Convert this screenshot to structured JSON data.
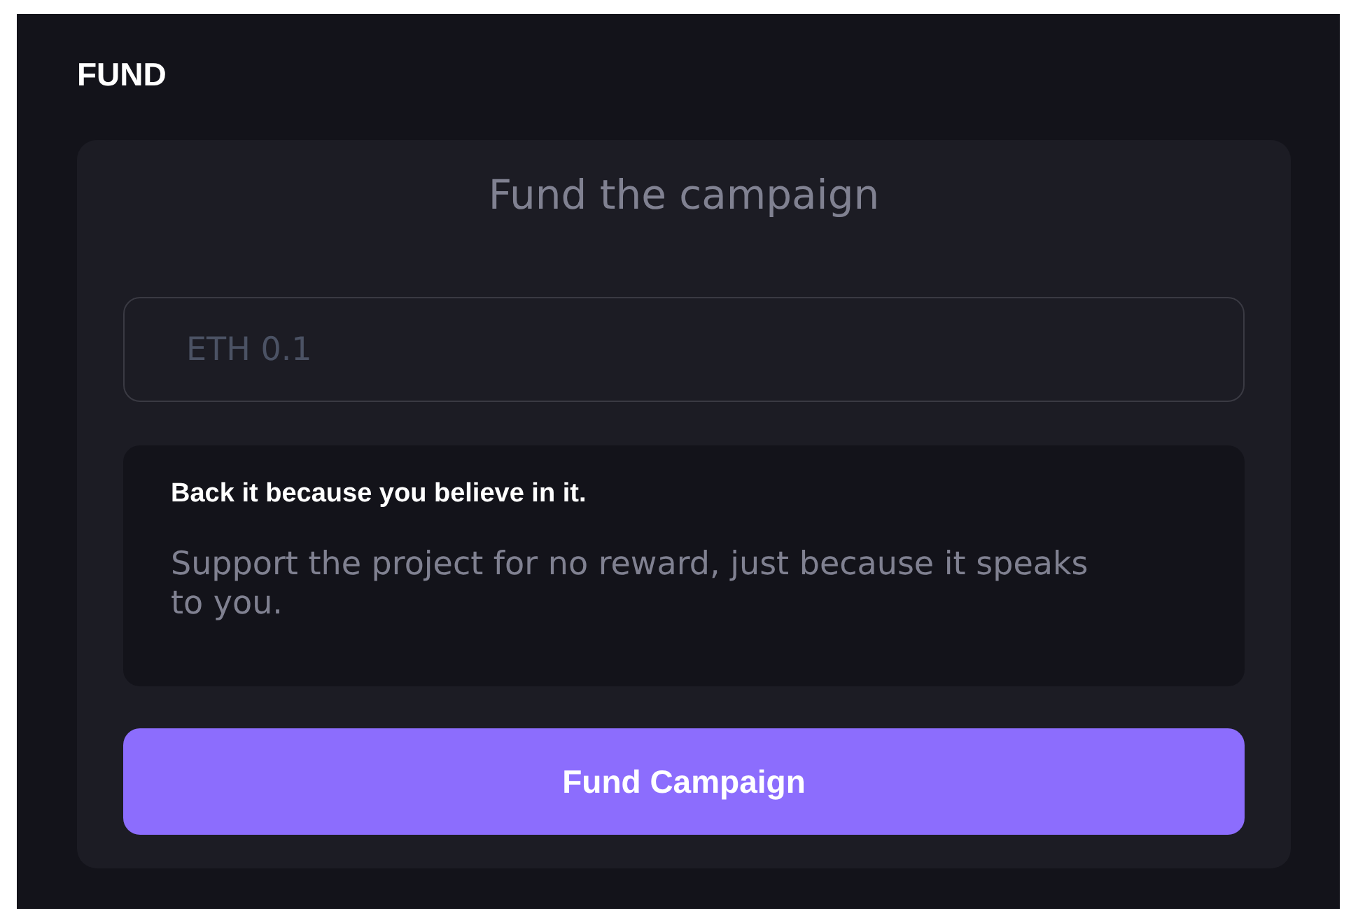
{
  "section_title": "FUND",
  "card": {
    "heading": "Fund the campaign",
    "amount_field": {
      "placeholder": "ETH 0.1"
    },
    "info": {
      "title": "Back it because you believe in it.",
      "text": "Support the project for no reward, just because it speaks to you."
    },
    "button": "Fund Campaign"
  }
}
